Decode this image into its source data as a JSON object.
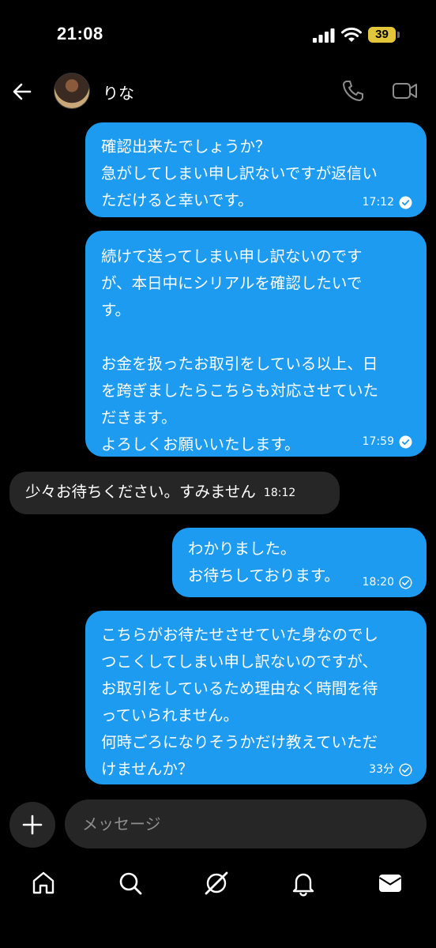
{
  "status_bar": {
    "time": "21:08",
    "battery": "39"
  },
  "header": {
    "contact_name": "りな"
  },
  "messages": [
    {
      "direction": "sent",
      "lines": [
        "確認出来たでしょうか？",
        "急がしてしまい申し訳ないですが返信い",
        "ただけると幸いです。"
      ],
      "time": "17:12",
      "status": "read"
    },
    {
      "direction": "sent",
      "lines": [
        "続けて送ってしまい申し訳ないのです",
        "が、本日中にシリアルを確認したいで",
        "す。",
        "",
        "お金を扱ったお取引をしている以上、日",
        "を跨ぎましたらこちらも対応させていた",
        "だきます。",
        "よろしくお願いいたします。"
      ],
      "time": "17:59",
      "status": "read"
    },
    {
      "direction": "received",
      "lines": [
        "少々お待ちください。すみません"
      ],
      "time": "18:12"
    },
    {
      "direction": "sent",
      "lines": [
        "わかりました。",
        "お待ちしております。"
      ],
      "time": "18:20",
      "status": "sent"
    },
    {
      "direction": "sent",
      "lines": [
        "こちらがお待たせさせていた身なのでし",
        "つこくしてしまい申し訳ないのですが、",
        "お取引をしているため理由なく時間を待",
        "っていられません。",
        "何時ごろになりそうかだけ教えていただ",
        "けませんか？"
      ],
      "time": "33分",
      "status": "sent"
    }
  ],
  "composer": {
    "placeholder": "メッセージ"
  },
  "tabs": [
    "home",
    "search",
    "grok",
    "notifications",
    "messages"
  ],
  "colors": {
    "sent_bubble": "#1d9bf0",
    "received_bubble": "#262626",
    "background": "#000000",
    "battery": "#e4c63a"
  }
}
